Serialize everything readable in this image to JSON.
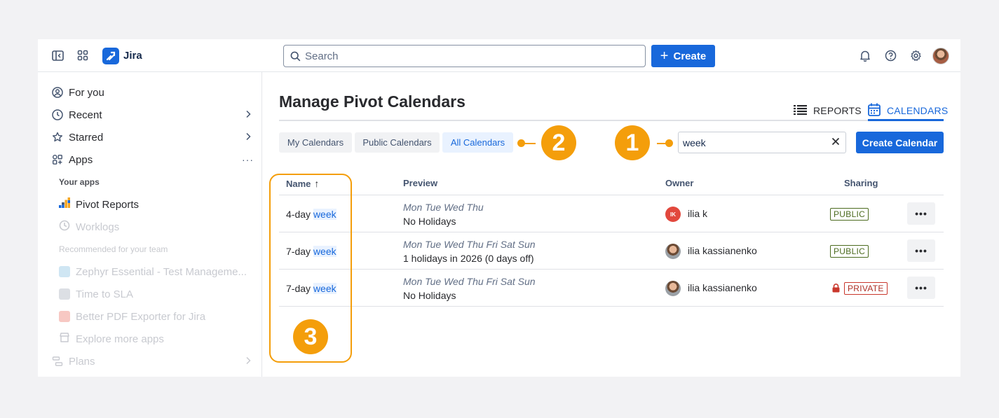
{
  "topbar": {
    "app_name": "Jira",
    "search_placeholder": "Search",
    "create_label": "Create",
    "icons": [
      "sidebar-toggle-icon",
      "app-switcher-icon",
      "bell-icon",
      "help-icon",
      "gear-icon"
    ]
  },
  "sidebar": {
    "items": [
      {
        "label": "For you",
        "icon": "user-circle-icon"
      },
      {
        "label": "Recent",
        "icon": "clock-icon"
      },
      {
        "label": "Starred",
        "icon": "star-icon"
      },
      {
        "label": "Apps",
        "icon": "apps-icon"
      }
    ],
    "your_apps_label": "Your apps",
    "apps": [
      {
        "label": "Pivot Reports"
      },
      {
        "label": "Worklogs"
      }
    ],
    "recommended_label": "Recommended for your team",
    "recommended": [
      {
        "label": "Zephyr Essential - Test Manageme..."
      },
      {
        "label": "Time to SLA"
      },
      {
        "label": "Better PDF Exporter for Jira"
      },
      {
        "label": "Explore more apps"
      }
    ],
    "plans_label": "Plans"
  },
  "main": {
    "title": "Manage Pivot Calendars",
    "view_tabs": {
      "reports": "REPORTS",
      "calendars": "CALENDARS"
    },
    "filters": [
      "My Calendars",
      "Public Calendars",
      "All Calendars"
    ],
    "active_filter": "All Calendars",
    "search_value": "week",
    "create_calendar_label": "Create Calendar",
    "callouts": [
      "1",
      "2",
      "3"
    ],
    "table": {
      "headers": {
        "name": "Name",
        "preview": "Preview",
        "owner": "Owner",
        "sharing": "Sharing"
      },
      "sort_indicator": "↑",
      "rows": [
        {
          "name_prefix": "4-day ",
          "name_match": "week",
          "days": "Mon Tue Wed Thu",
          "holidays": "No Holidays",
          "owner_initials": "IK",
          "owner": "ilia k",
          "sharing": "PUBLIC"
        },
        {
          "name_prefix": "7-day ",
          "name_match": "week",
          "days": "Mon Tue Wed Thu Fri Sat Sun",
          "holidays": "1 holidays in 2026 (0 days off)",
          "owner_initials": "",
          "owner": "ilia kassianenko",
          "sharing": "PUBLIC"
        },
        {
          "name_prefix": "7-day ",
          "name_match": "week",
          "days": "Mon Tue Wed Thu Fri Sat Sun",
          "holidays": "No Holidays",
          "owner_initials": "",
          "owner": "ilia kassianenko",
          "sharing": "PRIVATE"
        }
      ],
      "more_label": "•••"
    }
  },
  "colors": {
    "accent": "#1868db",
    "callout": "#f49e0b",
    "public": "#4c6b1f",
    "private": "#c9372c"
  }
}
